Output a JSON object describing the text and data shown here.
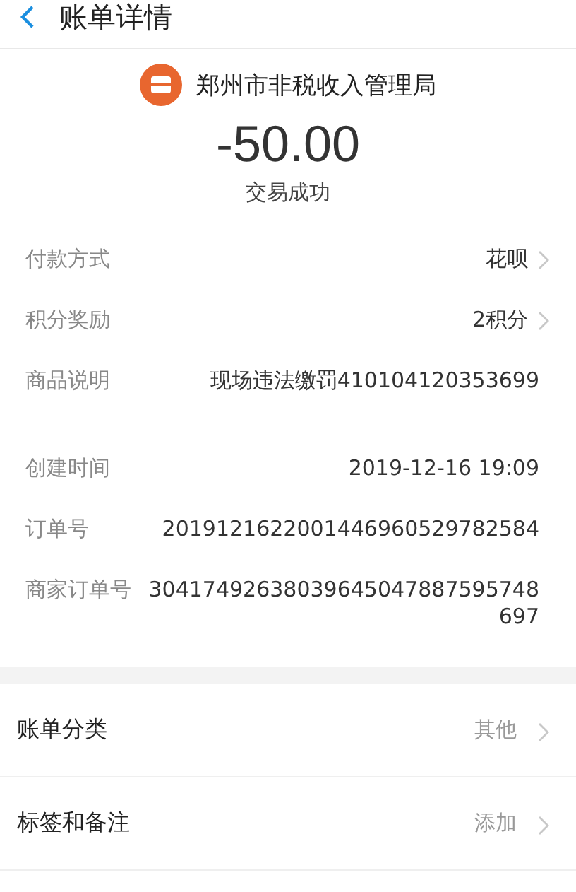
{
  "header": {
    "title": "账单详情"
  },
  "merchant": {
    "name": "郑州市非税收入管理局",
    "amount": "-50.00",
    "status": "交易成功"
  },
  "details": [
    {
      "label": "付款方式",
      "value": "花呗",
      "kind": "link"
    },
    {
      "label": "积分奖励",
      "value": "2积分",
      "kind": "link"
    },
    {
      "label": "商品说明",
      "value": "现场违法缴罚410104120353699",
      "kind": "info"
    },
    {
      "kind": "spacer"
    },
    {
      "label": "创建时间",
      "value": "2019-12-16 19:09",
      "kind": "info"
    },
    {
      "label": "订单号",
      "value": "2019121622001446960529782584",
      "kind": "info"
    },
    {
      "label": "商家订单号",
      "value": "30417492638039645047887595748697",
      "kind": "info"
    }
  ],
  "actions": [
    {
      "label": "账单分类",
      "value": "其他"
    },
    {
      "label": "标签和备注",
      "value": "添加"
    }
  ]
}
